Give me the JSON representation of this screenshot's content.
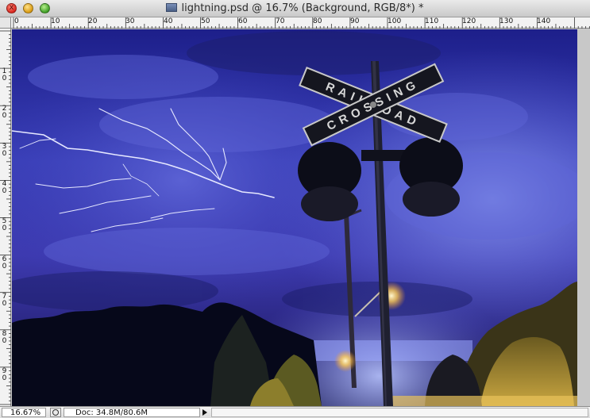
{
  "window": {
    "title": "lightning.psd @ 16.7% (Background, RGB/8*) *",
    "close_glyph": "x"
  },
  "rulers": {
    "top_labels": [
      "0",
      "10",
      "20",
      "30",
      "40",
      "50",
      "60",
      "70",
      "80",
      "90",
      "100",
      "110",
      "120",
      "130",
      "140"
    ],
    "left_labels": [
      "1|0",
      "2|0",
      "3|0",
      "4|0",
      "5|0",
      "6|0",
      "7|0",
      "8|0",
      "9|0"
    ]
  },
  "canvas": {
    "sign_top_text": "RAILROAD",
    "sign_bottom_text": "CROSSING",
    "sky_color": "#3a3fb8",
    "lightning_color": "#e6e8ff"
  },
  "status": {
    "zoom": "16.67%",
    "doc_info": "Doc: 34.8M/80.6M"
  },
  "icons": {
    "title_file": "psd-file-icon",
    "status_clock": "clock-icon",
    "status_menu": "arrow-right-icon"
  }
}
